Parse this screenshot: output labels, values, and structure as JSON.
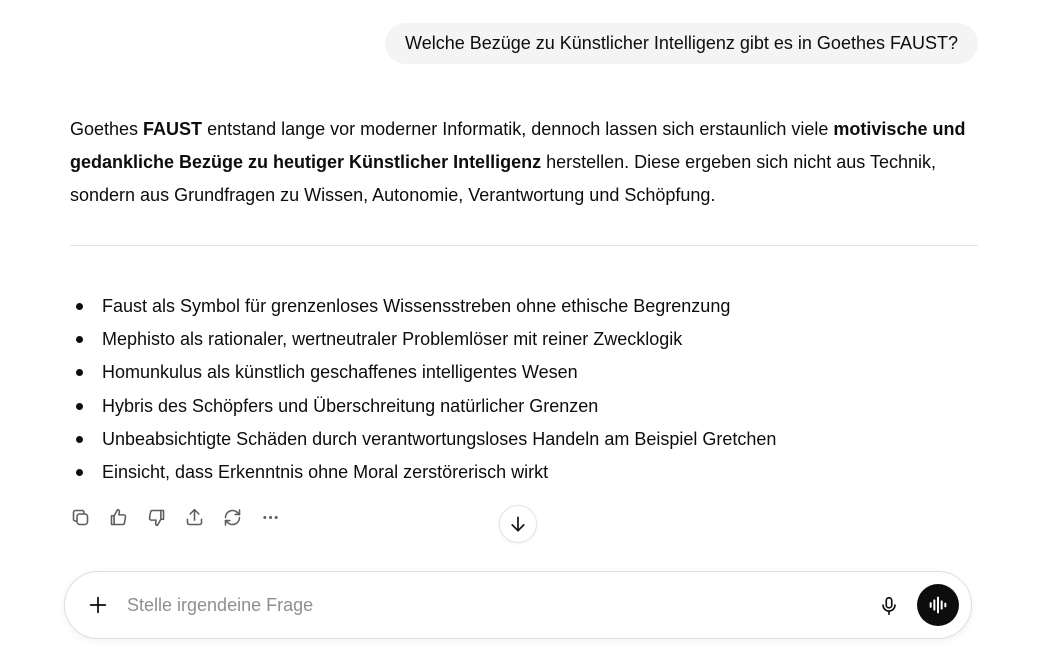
{
  "user_message": "Welche Bezüge zu Künstlicher Intelligenz gibt es in Goethes FAUST?",
  "answer": {
    "intro": {
      "t1": "Goethes ",
      "b1": "FAUST",
      "t2": " entstand lange vor moderner Informatik, dennoch lassen sich erstaunlich viele ",
      "b2": "motivische und gedankliche Bezüge zu heutiger Künstlicher Intelligenz",
      "t3": " herstellen. Diese ergeben sich nicht aus Technik, sondern aus Grundfragen zu Wissen, Autonomie, Verantwortung und Schöpfung."
    },
    "bullets": [
      "Faust als Symbol für grenzenloses Wissensstreben ohne ethische Begrenzung",
      "Mephisto als rationaler, wertneutraler Problemlöser mit reiner Zwecklogik",
      "Homunkulus als künstlich geschaffenes intelligentes Wesen",
      "Hybris des Schöpfers und Überschreitung natürlicher Grenzen",
      "Unbeabsichtigte Schäden durch verantwortungsloses Handeln am Beispiel Gretchen",
      "Einsicht, dass Erkenntnis ohne Moral zerstörerisch wirkt"
    ]
  },
  "actions": {
    "copy_icon": "copy-icon",
    "like_icon": "thumbs-up-icon",
    "dislike_icon": "thumbs-down-icon",
    "share_icon": "share-icon",
    "regenerate_icon": "regenerate-icon",
    "more_icon": "more-icon"
  },
  "composer": {
    "placeholder": "Stelle irgendeine Frage",
    "value": ""
  },
  "colors": {
    "text": "#0d0d0d",
    "bubble_bg": "#f4f4f4",
    "icon": "#5d5d5d",
    "voice_button_bg": "#0d0d0d"
  }
}
